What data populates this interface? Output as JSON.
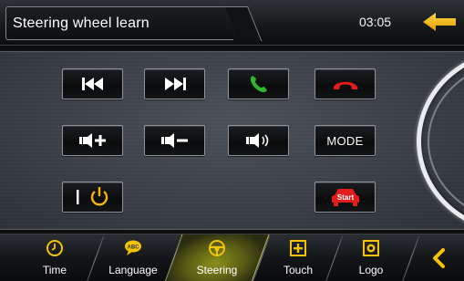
{
  "header": {
    "title": "Steering wheel learn",
    "time": "03:05",
    "back_icon": "back-arrow-icon",
    "accent_color": "#f5b400"
  },
  "keys": [
    {
      "name": "previous-track",
      "icon": "skip-back-icon"
    },
    {
      "name": "next-track",
      "icon": "skip-forward-icon"
    },
    {
      "name": "call-answer",
      "icon": "phone-answer-icon",
      "color": "#2fb52f"
    },
    {
      "name": "call-hangup",
      "icon": "phone-hangup-icon",
      "color": "#e21b1b"
    },
    {
      "name": "volume-up",
      "icon": "volume-plus-icon"
    },
    {
      "name": "volume-down",
      "icon": "volume-minus-icon"
    },
    {
      "name": "mute",
      "icon": "speaker-icon"
    },
    {
      "name": "mode",
      "label": "MODE"
    },
    {
      "name": "power",
      "icon": "power-icon",
      "color": "#f5b400"
    },
    {
      "name": "start",
      "icon": "car-start-icon",
      "label": "Start",
      "color": "#e21b1b"
    }
  ],
  "nav": {
    "items": [
      {
        "label": "Time",
        "icon": "clock-icon"
      },
      {
        "label": "Language",
        "icon": "abc-bubble-icon"
      },
      {
        "label": "Steering",
        "icon": "steering-wheel-icon",
        "active": true
      },
      {
        "label": "Touch",
        "icon": "touch-plus-icon"
      },
      {
        "label": "Logo",
        "icon": "logo-icon"
      }
    ],
    "more_icon": "chevron-left-icon"
  }
}
